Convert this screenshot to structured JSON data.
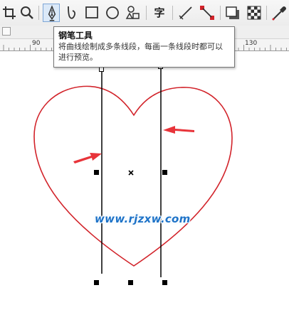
{
  "tooltip": {
    "title": "钢笔工具",
    "body": "将曲线绘制成多条线段，每画一条线段时都可以进行预览。"
  },
  "toolbar": {
    "text_tool_glyph": "字"
  },
  "ruler": {
    "labels": [
      "90",
      "130"
    ]
  },
  "watermark": {
    "text": "www.rjzxw.com"
  },
  "colors": {
    "heart_stroke": "#d2232a",
    "arrow": "#e8343a",
    "guide_line": "#000000",
    "watermark": "#1e73c8",
    "active_tool_bg": "#dbe9f8"
  },
  "icons": [
    "crop-icon",
    "zoom-icon",
    "pen-tool-icon",
    "bspline-icon",
    "rectangle-icon",
    "ellipse-icon",
    "polygon-icon",
    "text-icon",
    "line-icon",
    "connector-icon",
    "drop-shadow-icon",
    "transparency-icon",
    "eyedropper-icon"
  ]
}
